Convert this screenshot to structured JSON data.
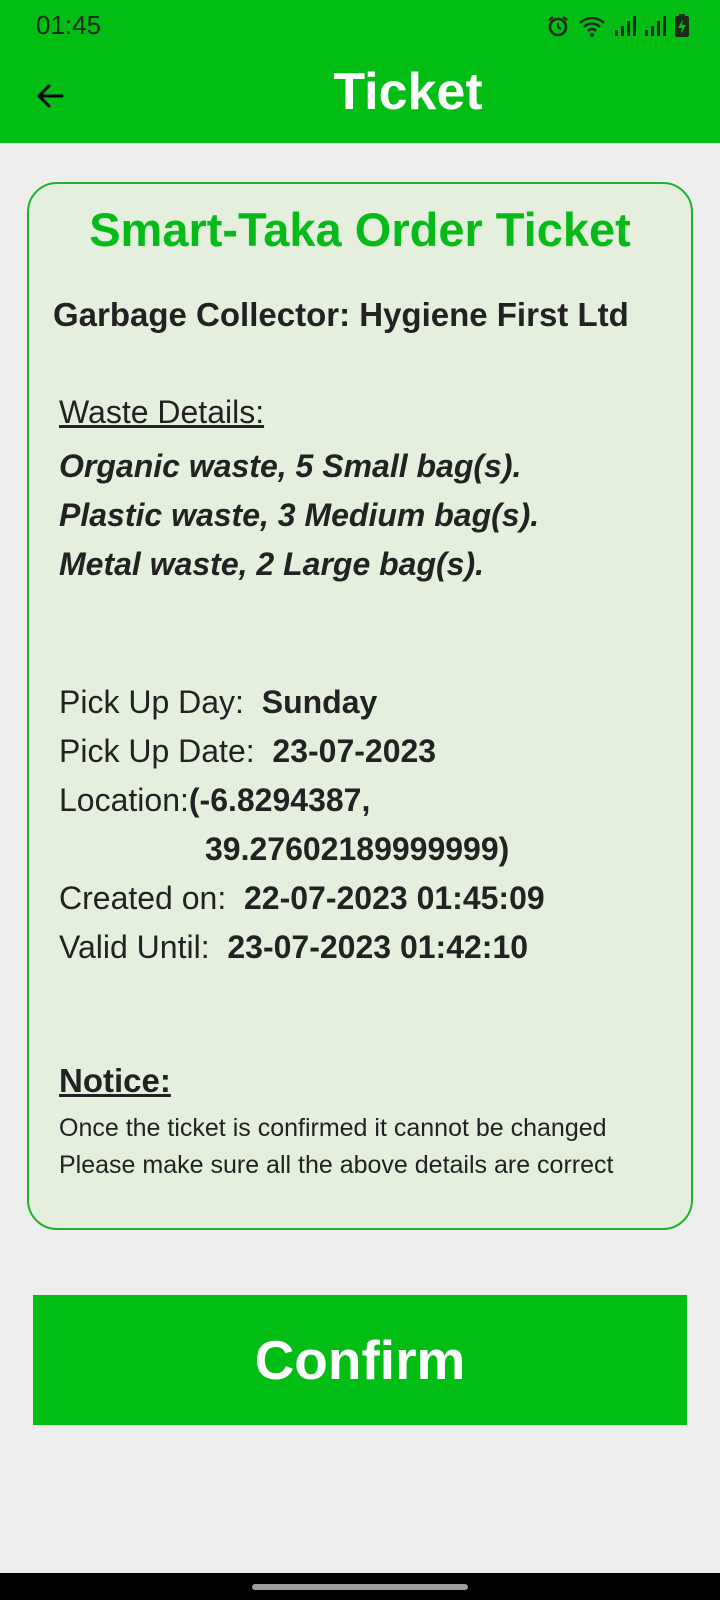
{
  "status_bar": {
    "time": "01:45",
    "icons": [
      "alarm-icon",
      "wifi-icon",
      "signal-icon",
      "signal-icon",
      "battery-charging-icon"
    ]
  },
  "app_bar": {
    "title": "Ticket",
    "back_icon": "arrow-left-icon"
  },
  "ticket": {
    "title": "Smart-Taka Order Ticket",
    "collector": "Garbage Collector: Hygiene First Ltd",
    "waste_heading": "Waste Details:",
    "waste_items": [
      "Organic waste, 5 Small bag(s).",
      "Plastic waste, 3 Medium bag(s).",
      "Metal waste, 2 Large bag(s)."
    ],
    "pickup_day_label": "Pick Up Day:",
    "pickup_day": "Sunday",
    "pickup_date_label": "Pick Up Date:",
    "pickup_date": "23-07-2023",
    "location_label": "Location:",
    "location_line1": "(-6.8294387,",
    "location_line2": "39.27602189999999)",
    "created_label": "Created on:",
    "created_value": "22-07-2023 01:45:09",
    "valid_label": "Valid Until:",
    "valid_value": "23-07-2023 01:42:10",
    "notice_heading": "Notice:",
    "notice_line1": "Once the ticket is confirmed it cannot be changed",
    "notice_line2": "Please make sure all the above details are correct"
  },
  "confirm_button": {
    "label": "Confirm"
  },
  "colors": {
    "accent_green": "#02bd13",
    "card_background": "#e5efdd",
    "page_background": "#eeeeee"
  }
}
